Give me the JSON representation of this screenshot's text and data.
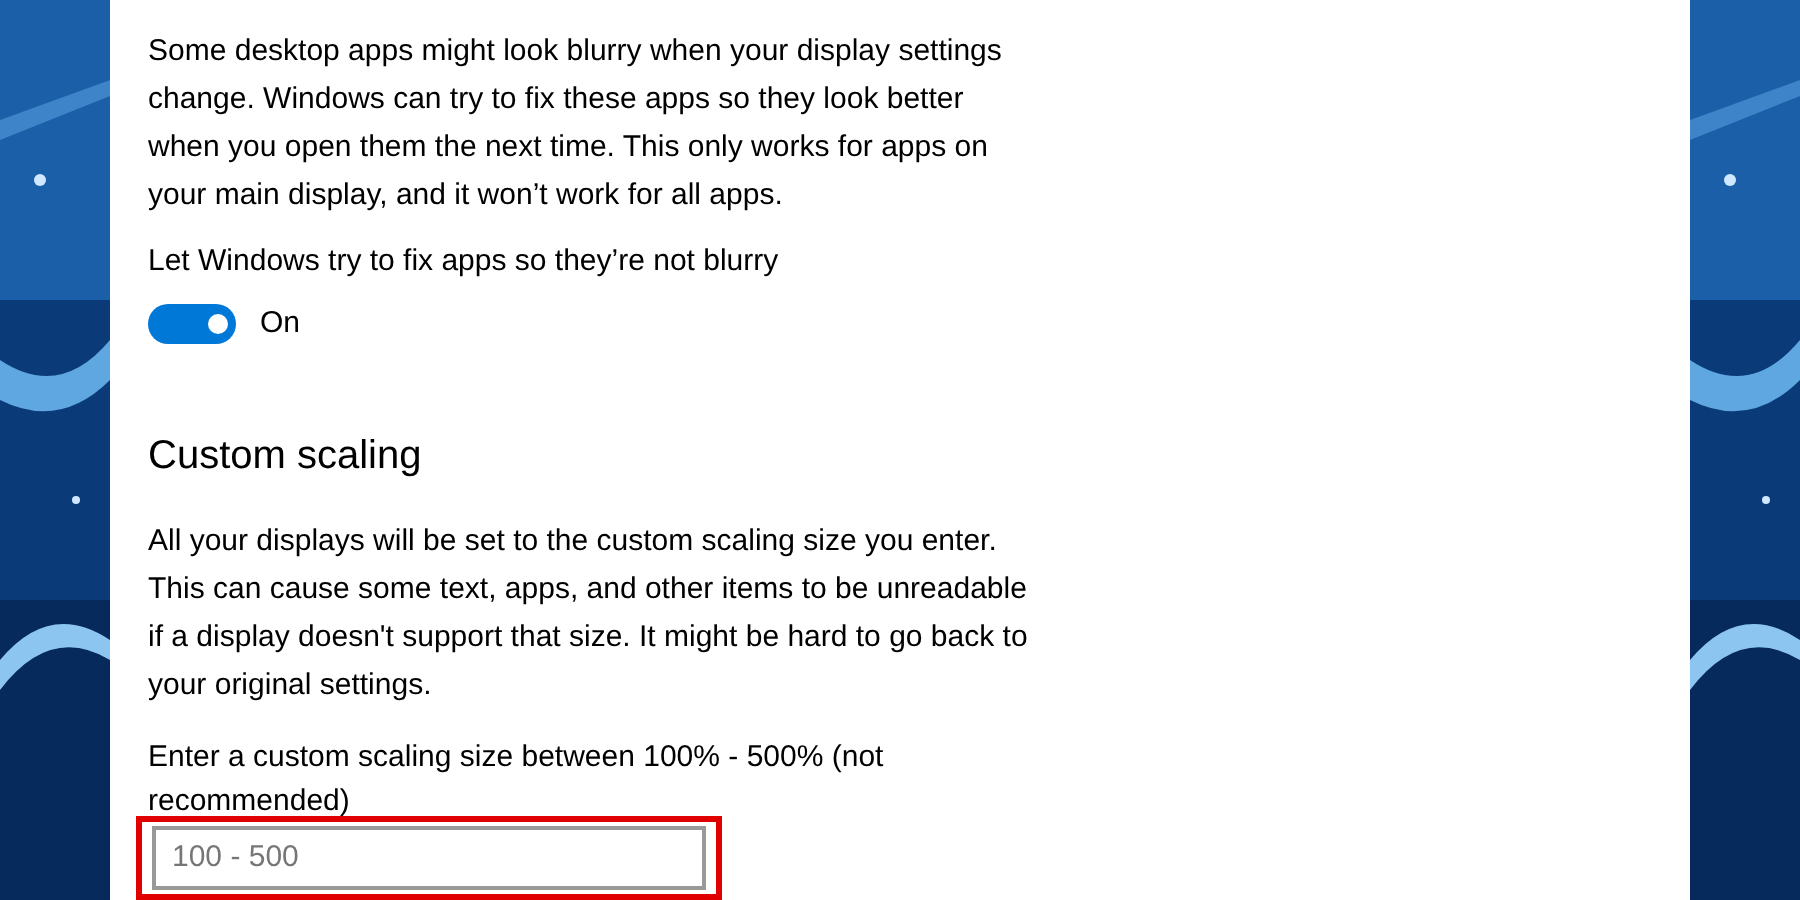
{
  "intro": "Some desktop apps might look blurry when your display settings change. Windows can try to fix these apps so they look better when you open them the next time. This only works for apps on your main display, and it won’t work for all apps.",
  "fix_toggle": {
    "label": "Let Windows try to fix apps so they’re not blurry",
    "on": true,
    "state_text": "On"
  },
  "custom_scaling": {
    "heading": "Custom scaling",
    "description": "All your displays will be set to the custom scaling size you enter. This can cause some text, apps, and other items to be unreadable if a display doesn't support that size. It might be hard to go back to your original settings.",
    "field_label": "Enter a custom scaling size between 100% - 500% (not recommended)",
    "field": {
      "placeholder": "100 - 500",
      "highlighted": true
    }
  }
}
